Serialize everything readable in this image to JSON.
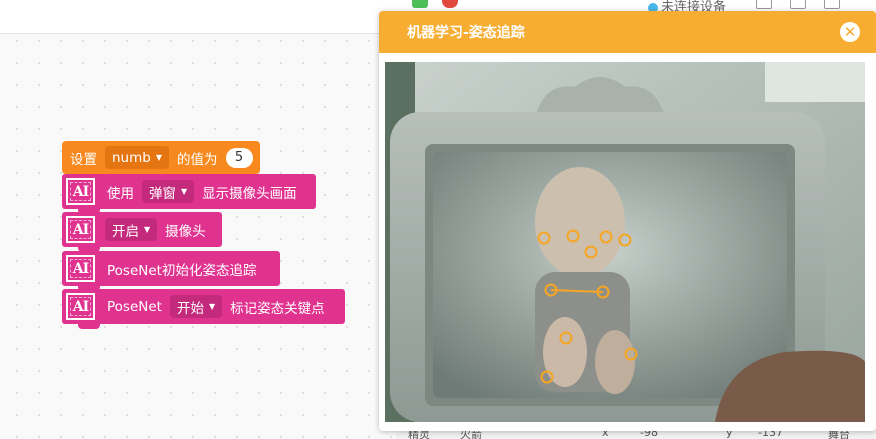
{
  "topbar": {
    "device_status": "未连接设备"
  },
  "blocks": {
    "set_var": {
      "prefix": "设置",
      "variable": "numb",
      "middle": "的值为",
      "value": "5"
    },
    "show_camera": {
      "icon": "AI",
      "prefix": "使用",
      "mode": "弹窗",
      "suffix": "显示摄像头画面"
    },
    "camera_toggle": {
      "icon": "AI",
      "state": "开启",
      "suffix": "摄像头"
    },
    "posenet_init": {
      "icon": "AI",
      "label": "PoseNet初始化姿态追踪"
    },
    "posenet_mark": {
      "icon": "AI",
      "prefix": "PoseNet",
      "action": "开始",
      "suffix": "标记姿态关键点"
    }
  },
  "modal": {
    "title": "机器学习-姿态追踪",
    "close_symbol": "✕"
  },
  "pose": {
    "keypoint_color": "#f5a623"
  },
  "bottom_strip": {
    "items": [
      "精灵",
      "火箭",
      "x",
      "-98",
      "y",
      "-137",
      "舞台"
    ]
  }
}
